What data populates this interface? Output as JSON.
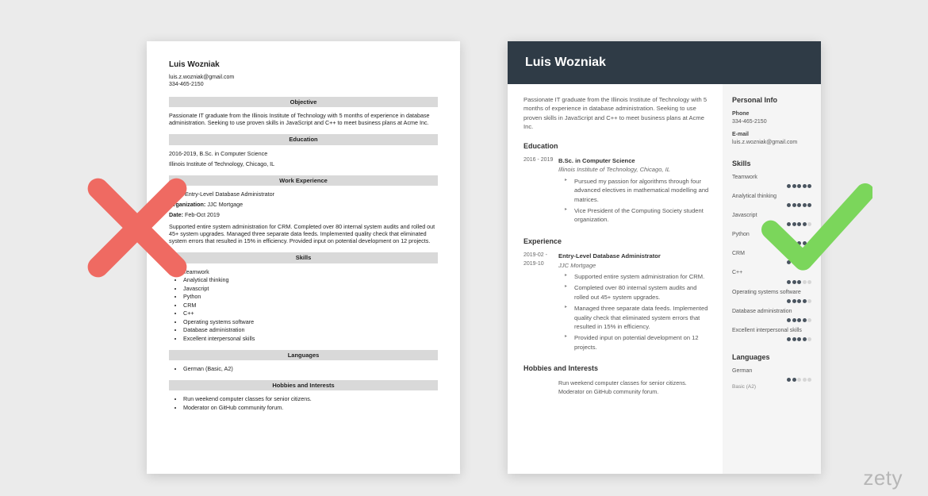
{
  "brand": "zety",
  "left": {
    "name": "Luis Wozniak",
    "email": "luis.z.wozniak@gmail.com",
    "phone": "334-465-2150",
    "sections": {
      "objective": "Objective",
      "education": "Education",
      "work": "Work Experience",
      "skills": "Skills",
      "languages": "Languages",
      "hobbies": "Hobbies and Interests"
    },
    "objective_text": "Passionate IT graduate from the Illinois Institute of Technology with 5 months of experience in database administration. Seeking to use proven skills in JavaScript and C++ to meet business plans at Acme Inc.",
    "edu_line1": "2016-2019, B.Sc. in Computer Science",
    "edu_line2": "Illinois Institute of Technology, Chicago, IL",
    "post_label": "Post:",
    "post_value": " Entry-Level Database Administrator",
    "org_label": "Organization:",
    "org_value": " JJC Mortgage",
    "date_label": "Date:",
    "date_value": " Feb-Oct 2019",
    "work_text": "Supported entire system administration for CRM. Completed over 80 internal system audits and rolled out 45+ system upgrades. Managed three separate data feeds. Implemented quality check that eliminated system errors that resulted in 15% in efficiency. Provided input on potential development on 12 projects.",
    "skills": [
      "Teamwork",
      "Analytical thinking",
      "Javascript",
      "Python",
      "CRM",
      "C++",
      "Operating systems software",
      "Database administration",
      "Excellent interpersonal skills"
    ],
    "languages": [
      "German (Basic, A2)"
    ],
    "hobbies": [
      "Run weekend computer classes for senior citizens.",
      "Moderator on GitHub community forum."
    ]
  },
  "right": {
    "name": "Luis Wozniak",
    "summary": "Passionate IT graduate from the Illinois Institute of Technology with 5 months of experience in database administration. Seeking to use proven skills in JavaScript and C++ to meet business plans at Acme Inc.",
    "headings": {
      "education": "Education",
      "experience": "Experience",
      "hobbies": "Hobbies and Interests",
      "personal": "Personal Info",
      "skills": "Skills",
      "languages": "Languages"
    },
    "edu": {
      "dates": "2016 - 2019",
      "title": "B.Sc. in Computer Science",
      "org": "Illinois Institute of Technology, Chicago, IL",
      "bullets": [
        "Pursued my passion for algorithms through four advanced electives in mathematical modelling and matrices.",
        "Vice President of the Computing Society student organization."
      ]
    },
    "exp": {
      "dates": "2019-02 - 2019-10",
      "title": "Entry-Level Database Administrator",
      "org": "JJC Mortgage",
      "bullets": [
        "Supported entire system administration for CRM.",
        "Completed over 80 internal system audits and rolled out 45+ system upgrades.",
        "Managed three separate data feeds. Implemented quality check that eliminated system errors that resulted in 15% in efficiency.",
        "Provided input on potential development on 12 projects."
      ]
    },
    "hobbies": [
      "Run weekend computer classes for senior citizens.",
      "Moderator on GitHub community forum."
    ],
    "personal": {
      "phone_label": "Phone",
      "phone": "334-465-2150",
      "email_label": "E-mail",
      "email": "luis.z.wozniak@gmail.com"
    },
    "skills": [
      {
        "name": "Teamwork",
        "level": 5
      },
      {
        "name": "Analytical thinking",
        "level": 5
      },
      {
        "name": "Javascript",
        "level": 4
      },
      {
        "name": "Python",
        "level": 4
      },
      {
        "name": "CRM",
        "level": 5
      },
      {
        "name": "C++",
        "level": 3
      },
      {
        "name": "Operating systems software",
        "level": 4
      },
      {
        "name": "Database administration",
        "level": 4
      },
      {
        "name": "Excellent interpersonal skills",
        "level": 4
      }
    ],
    "language": {
      "name": "German",
      "level": 2,
      "note": "Basic (A2)"
    }
  }
}
